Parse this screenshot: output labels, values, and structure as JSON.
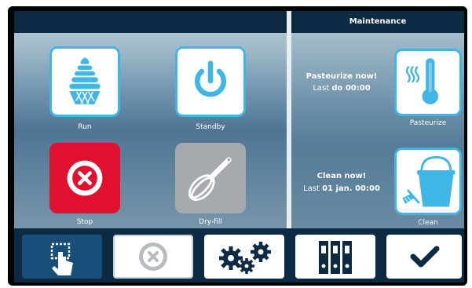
{
  "right_panel": {
    "title": "Maintenance"
  },
  "tiles": {
    "run": {
      "label": "Run",
      "icon": "soft-serve-icon"
    },
    "standby": {
      "label": "Standby",
      "icon": "power-icon"
    },
    "stop": {
      "label": "Stop",
      "icon": "stop-x-icon"
    },
    "dryfill": {
      "label": "Dry-fill",
      "icon": "whisk-icon"
    }
  },
  "maintenance": {
    "pasteurize": {
      "prompt": "Pasteurize now!",
      "last_prefix": "Last ",
      "last_value": "do 00:00",
      "button_label": "Pasteurize",
      "icon": "thermometer-icon"
    },
    "clean": {
      "prompt": "Clean now!",
      "last_prefix": "Last ",
      "last_value": "01 jan. 00:00",
      "button_label": "Clean",
      "icon": "bucket-icon"
    }
  },
  "bottom_bar": [
    {
      "icon": "touch-select-icon",
      "state": "active"
    },
    {
      "icon": "cancel-icon",
      "state": "disabled"
    },
    {
      "icon": "gears-icon",
      "state": "normal"
    },
    {
      "icon": "binders-icon",
      "state": "normal"
    },
    {
      "icon": "checkmark-icon",
      "state": "normal"
    }
  ],
  "colors": {
    "accent": "#3fb6e6",
    "dark": "#0d2a44",
    "stop_red": "#e0102e",
    "disabled_grey": "#a6aaae"
  }
}
